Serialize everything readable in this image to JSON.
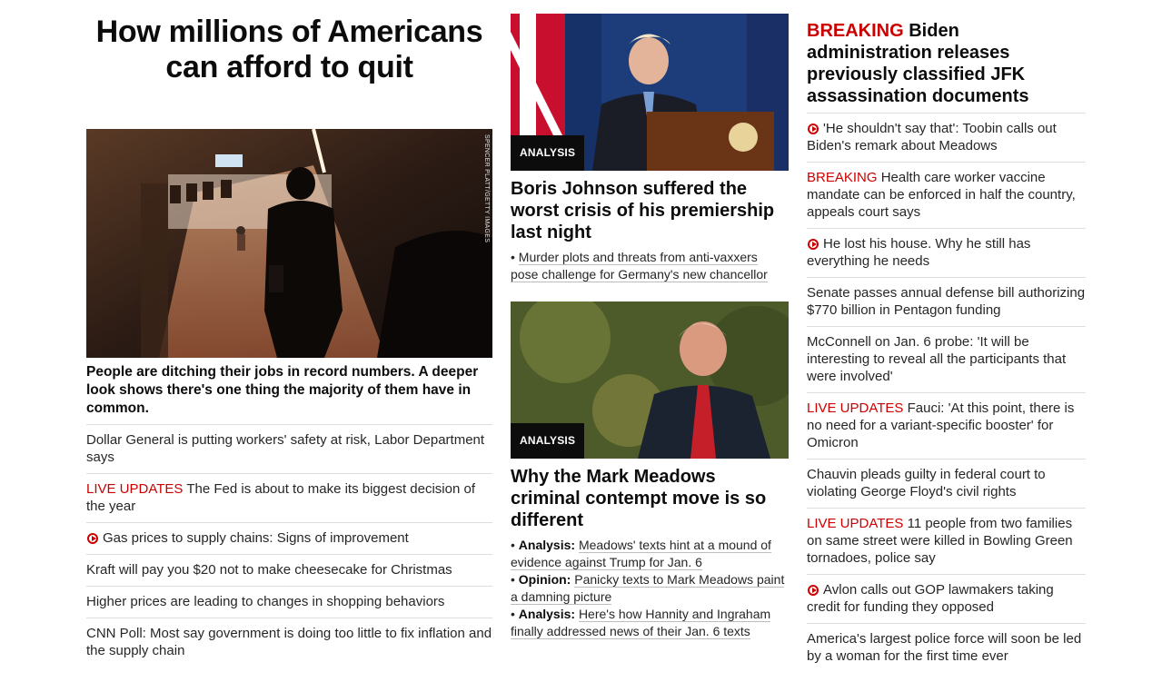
{
  "left": {
    "hero_title": "How millions of Americans can afford to quit",
    "photo_credit": "SPENCER PLATT/GETTY IMAGES",
    "hero_description": "People are ditching their jobs in record numbers. A deeper look shows there's one thing the majority of them have in common.",
    "headlines": [
      {
        "prefix": "",
        "video": false,
        "text": "Dollar General is putting workers' safety at risk, Labor Department says"
      },
      {
        "prefix": "LIVE UPDATES",
        "video": false,
        "text": "The Fed is about to make its biggest decision of the year"
      },
      {
        "prefix": "",
        "video": true,
        "text": "Gas prices to supply chains: Signs of improvement"
      },
      {
        "prefix": "",
        "video": false,
        "text": "Kraft will pay you $20 not to make cheesecake for Christmas"
      },
      {
        "prefix": "",
        "video": false,
        "text": "Higher prices are leading to changes in shopping behaviors"
      },
      {
        "prefix": "",
        "video": false,
        "text": "CNN Poll: Most say government is doing too little to fix inflation and the supply chain"
      }
    ]
  },
  "middle": {
    "card1": {
      "badge": "ANALYSIS",
      "title": "Boris Johnson suffered the worst crisis of his premiership last night",
      "bullets": [
        {
          "label": "",
          "text": "Murder plots and threats from anti-vaxxers pose challenge for Germany's new chancellor"
        }
      ]
    },
    "card2": {
      "badge": "ANALYSIS",
      "title": "Why the Mark Meadows criminal contempt move is so different",
      "bullets": [
        {
          "label": "Analysis:",
          "text": "Meadows' texts hint at a mound of evidence against Trump for Jan. 6"
        },
        {
          "label": "Opinion:",
          "text": "Panicky texts to Mark Meadows paint a damning picture"
        },
        {
          "label": "Analysis:",
          "text": "Here's how Hannity and Ingraham finally addressed news of their Jan. 6 texts"
        }
      ]
    }
  },
  "right": {
    "breaking_label": "BREAKING",
    "breaking_title": "Biden administration releases previously classified JFK assassination documents",
    "headlines": [
      {
        "prefix": "",
        "video": true,
        "text": "'He shouldn't say that': Toobin calls out Biden's remark about Meadows"
      },
      {
        "prefix": "BREAKING",
        "video": false,
        "text": "Health care worker vaccine mandate can be enforced in half the country, appeals court says"
      },
      {
        "prefix": "",
        "video": true,
        "text": "He lost his house. Why he still has everything he needs"
      },
      {
        "prefix": "",
        "video": false,
        "text": "Senate passes annual defense bill authorizing $770 billion in Pentagon funding"
      },
      {
        "prefix": "",
        "video": false,
        "text": "McConnell on Jan. 6 probe: 'It will be interesting to reveal all the participants that were involved'"
      },
      {
        "prefix": "LIVE UPDATES",
        "video": false,
        "text": "Fauci: 'At this point, there is no need for a variant-specific booster' for Omicron"
      },
      {
        "prefix": "",
        "video": false,
        "text": "Chauvin pleads guilty in federal court to violating George Floyd's civil rights"
      },
      {
        "prefix": "LIVE UPDATES",
        "video": false,
        "text": "11 people from two families on same street were killed in Bowling Green tornadoes, police say"
      },
      {
        "prefix": "",
        "video": true,
        "text": "Avlon calls out GOP lawmakers taking credit for funding they opposed"
      },
      {
        "prefix": "",
        "video": false,
        "text": "America's largest police force will soon be led by a woman for the first time ever"
      }
    ]
  },
  "colors": {
    "accent_red": "#cc0000",
    "text": "#0c0c0c",
    "divider": "#dedede"
  }
}
